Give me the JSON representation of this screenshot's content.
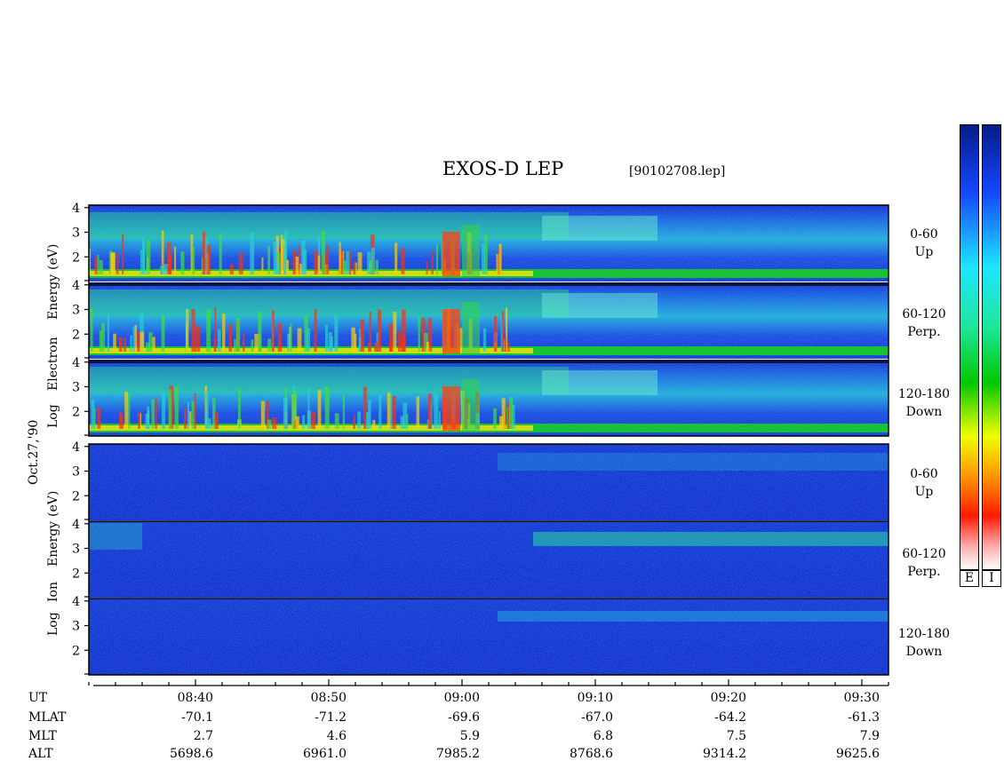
{
  "title": "EXOS-D LEP",
  "file_label": "[90102708.lep]",
  "date_label": "Oct.27,'90",
  "electron_axis_label": [
    "Log",
    "Electron",
    "Energy",
    "(eV)"
  ],
  "ion_axis_label": [
    "Log",
    "Ion",
    "Energy",
    "(eV)"
  ],
  "colors": {
    "background_panel": "#1a3fd6",
    "accent_hot": "#ff2000"
  },
  "colorbar": {
    "left_label": "E",
    "right_label": "I"
  },
  "chart_data": [
    {
      "type": "heatmap",
      "title": "",
      "group": "Electron",
      "panels": [
        {
          "name": "0-60 Up",
          "pitch": "0-60",
          "direction": "Up"
        },
        {
          "name": "60-120 Perp.",
          "pitch": "60-120",
          "direction": "Perp."
        },
        {
          "name": "120-180 Down",
          "pitch": "120-180",
          "direction": "Down"
        }
      ],
      "ylim": [
        1,
        4
      ],
      "yticks": [
        "4",
        "3",
        "2"
      ],
      "ylabel": "Log Electron Energy (eV)"
    },
    {
      "type": "heatmap",
      "title": "",
      "group": "Ion",
      "panels": [
        {
          "name": "0-60 Up",
          "pitch": "0-60",
          "direction": "Up"
        },
        {
          "name": "60-120 Perp.",
          "pitch": "60-120",
          "direction": "Perp."
        },
        {
          "name": "120-180 Down",
          "pitch": "120-180",
          "direction": "Down"
        }
      ],
      "ylim": [
        1,
        4
      ],
      "yticks": [
        "4",
        "3",
        "2"
      ],
      "ylabel": "Log Ion Energy (eV)"
    }
  ],
  "time_axis": {
    "xlim_minutes": [
      512,
      572
    ],
    "major_ticks": [
      520,
      530,
      540,
      550,
      560,
      570
    ],
    "rows": [
      {
        "label": "UT",
        "values": [
          "08:40",
          "08:50",
          "09:00",
          "09:10",
          "09:20",
          "09:30"
        ]
      },
      {
        "label": "MLAT",
        "values": [
          "-70.1",
          "-71.2",
          "-69.6",
          "-67.0",
          "-64.2",
          "-61.3"
        ]
      },
      {
        "label": "MLT",
        "values": [
          "2.7",
          "4.6",
          "5.9",
          "6.8",
          "7.5",
          "7.9"
        ]
      },
      {
        "label": "ALT",
        "values": [
          "5698.6",
          "6961.0",
          "7985.2",
          "8768.6",
          "9314.2",
          "9625.6"
        ]
      }
    ]
  }
}
